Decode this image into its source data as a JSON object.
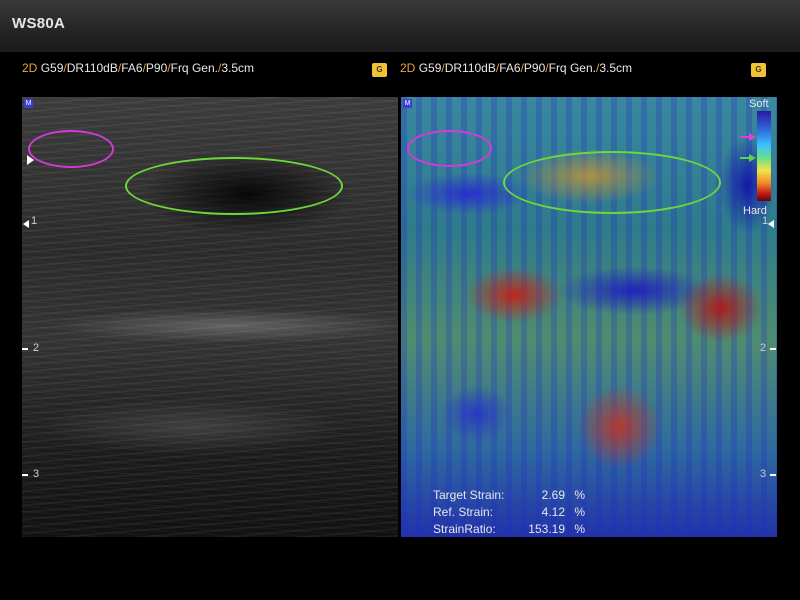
{
  "app": {
    "title": "WS80A"
  },
  "left_header": {
    "mode": "2D",
    "gain": "G59",
    "dr": "DR110dB",
    "fa": "FA6",
    "power": "P90",
    "freq": "Frq Gen.",
    "depth": "3.5cm"
  },
  "right_header": {
    "mode": "2D",
    "gain": "G59",
    "dr": "DR110dB",
    "fa": "FA6",
    "power": "P90",
    "freq": "Frq Gen.",
    "depth": "3.5cm"
  },
  "icons": {
    "settings": "config-icon",
    "cfg_label": "G",
    "marker": "M"
  },
  "depth_scale": {
    "labels": [
      "1",
      "2",
      "3"
    ]
  },
  "colorbar": {
    "soft": "Soft",
    "hard": "Hard"
  },
  "strain": {
    "target_label": "Target Strain:",
    "target_value": "2.69",
    "target_unit": "%",
    "ref_label": "Ref. Strain:",
    "ref_value": "4.12",
    "ref_unit": "%",
    "ratio_label": "StrainRatio:",
    "ratio_value": "153.19",
    "ratio_unit": "%"
  },
  "colors": {
    "accent": "#e6a23c",
    "roi_ref": "#d53ad6",
    "roi_target": "#6cd83a",
    "arrow_soft": "#e040e0",
    "arrow_target": "#5ed24a"
  }
}
